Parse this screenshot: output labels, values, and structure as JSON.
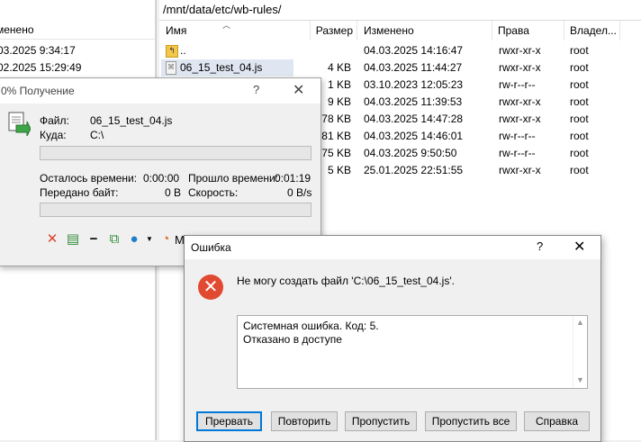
{
  "left_panel": {
    "header": "менено",
    "rows": [
      "03.2025 9:34:17",
      "02.2025 15:29:49"
    ]
  },
  "right_panel": {
    "path": "/mnt/data/etc/wb-rules/",
    "columns": {
      "name": "Имя",
      "size": "Размер",
      "modified": "Изменено",
      "rights": "Права",
      "owner": "Владел..."
    },
    "files": [
      {
        "name": "..",
        "size": "",
        "modified": "04.03.2025 14:16:47",
        "rights": "rwxr-xr-x",
        "owner": "root"
      },
      {
        "name": "06_15_test_04.js",
        "size": "4 KB",
        "modified": "04.03.2025 11:44:27",
        "rights": "rwxr-xr-x",
        "owner": "root"
      },
      {
        "name": "",
        "size": "1 KB",
        "modified": "03.10.2023 12:05:23",
        "rights": "rw-r--r--",
        "owner": "root"
      },
      {
        "name": "",
        "size": "9 KB",
        "modified": "04.03.2025 11:39:53",
        "rights": "rwxr-xr-x",
        "owner": "root"
      },
      {
        "name": "",
        "size": "78 KB",
        "modified": "04.03.2025 14:47:28",
        "rights": "rwxr-xr-x",
        "owner": "root"
      },
      {
        "name": "",
        "size": "81 KB",
        "modified": "04.03.2025 14:46:01",
        "rights": "rw-r--r--",
        "owner": "root"
      },
      {
        "name": "",
        "size": "75 KB",
        "modified": "04.03.2025 9:50:50",
        "rights": "rw-r--r--",
        "owner": "root"
      },
      {
        "name": "",
        "size": "5 KB",
        "modified": "25.01.2025 22:51:55",
        "rights": "rwxr-xr-x",
        "owner": "root"
      }
    ]
  },
  "transfer_dialog": {
    "title": "0% Получение",
    "help": "?",
    "close": "✕",
    "file_label": "Файл:",
    "file_value": "06_15_test_04.js",
    "dest_label": "Куда:",
    "dest_value": "C:\\",
    "time_left_label": "Осталось времени:",
    "time_left_value": "0:00:00",
    "elapsed_label": "Прошло времени:",
    "elapsed_value": "0:01:19",
    "bytes_label": "Передано байт:",
    "bytes_value": "0 B",
    "speed_label": "Скорость:",
    "speed_value": "0 B/s",
    "file_progress": 0,
    "total_progress": 0,
    "minimize_label": "M",
    "icons": [
      "cancel-icon",
      "skip-icon",
      "minimize-icon",
      "background-icon",
      "speed-icon",
      "dropdown-icon",
      "timer-icon"
    ]
  },
  "error_dialog": {
    "title": "Ошибка",
    "help": "?",
    "close": "✕",
    "message": "Не могу создать файл 'C:\\06_15_test_04.js'.",
    "details_line1": "Системная ошибка. Код: 5.",
    "details_line2": "Отказано в доступе",
    "buttons": {
      "abort": "Прервать",
      "retry": "Повторить",
      "skip": "Пропустить",
      "skip_all": "Пропустить все",
      "help": "Справка"
    }
  }
}
